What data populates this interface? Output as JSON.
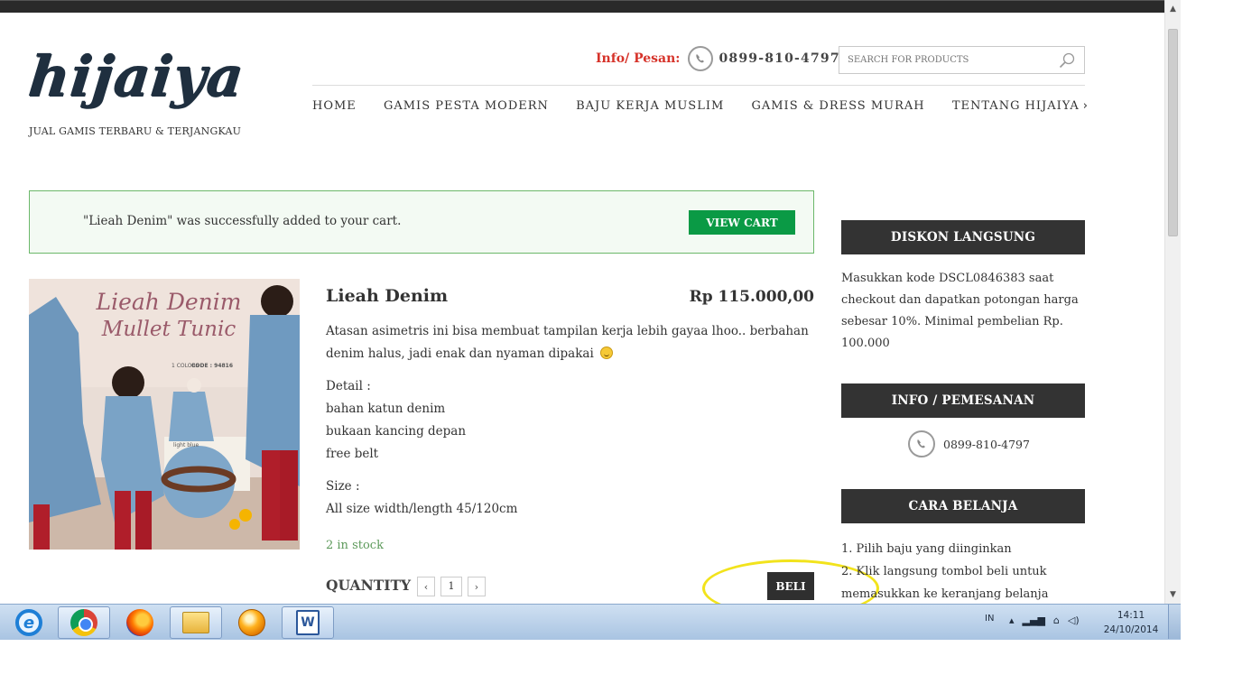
{
  "header": {
    "logo": "hijaiya",
    "tagline": "JUAL GAMIS TERBARU & TERJANGKAU",
    "info_label": "Info/ Pesan:",
    "phone": "0899-810-4797",
    "search_placeholder": "SEARCH FOR PRODUCTS"
  },
  "nav": {
    "items": [
      {
        "label": "HOME"
      },
      {
        "label": "GAMIS PESTA MODERN"
      },
      {
        "label": "BAJU KERJA MUSLIM"
      },
      {
        "label": "GAMIS & DRESS MURAH"
      },
      {
        "label": "TENTANG HIJAIYA"
      }
    ],
    "more_chevron": "›"
  },
  "notice": {
    "text": "\"Lieah Denim\" was successfully added to your cart.",
    "button": "VIEW CART"
  },
  "product": {
    "image_text_1": "Lieah Denim",
    "image_text_2": "Mullet Tunic",
    "image_code": "CODE : 94816",
    "image_colors": "1 COLORS",
    "image_swatch": "light blue",
    "title": "Lieah Denim",
    "price": "Rp 115.000,00",
    "description": "Atasan asimetris ini bisa membuat tampilan kerja lebih gayaa lhoo.. berbahan denim halus, jadi enak dan nyaman dipakai",
    "detail_label": "Detail :",
    "details": [
      "bahan katun denim",
      "bukaan kancing depan",
      "free belt"
    ],
    "size_label": "Size :",
    "size_value": "All size width/length 45/120cm",
    "stock": "2 in stock",
    "quantity_label": "QUANTITY",
    "qty_minus": "‹",
    "qty_value": "1",
    "qty_plus": "›",
    "buy_button": "BELI",
    "highlight_color": "#f2e31c"
  },
  "sidebar": {
    "diskon_title": "DISKON LANGSUNG",
    "diskon_text": "Masukkan kode DSCL0846383 saat checkout dan dapatkan potongan harga sebesar 10%. Minimal pembelian Rp. 100.000",
    "info_title": "INFO / PEMESANAN",
    "info_phone": "0899-810-4797",
    "cara_title": "CARA BELANJA",
    "steps": [
      "1. Pilih baju yang diinginkan",
      "2. Klik langsung tombol beli untuk",
      "memasukkan ke keranjang belanja"
    ]
  },
  "taskbar": {
    "apps": [
      "internet-explorer",
      "chrome",
      "firefox",
      "windows-explorer",
      "app",
      "word"
    ],
    "language": "IN",
    "time": "14:11",
    "date": "24/10/2014"
  },
  "colors": {
    "accent_red": "#d6332a",
    "view_cart_green": "#0a9a45",
    "notice_border": "#6cb86a",
    "sidebar_head_bg": "#333333",
    "stock_green": "#5d9a5b"
  }
}
